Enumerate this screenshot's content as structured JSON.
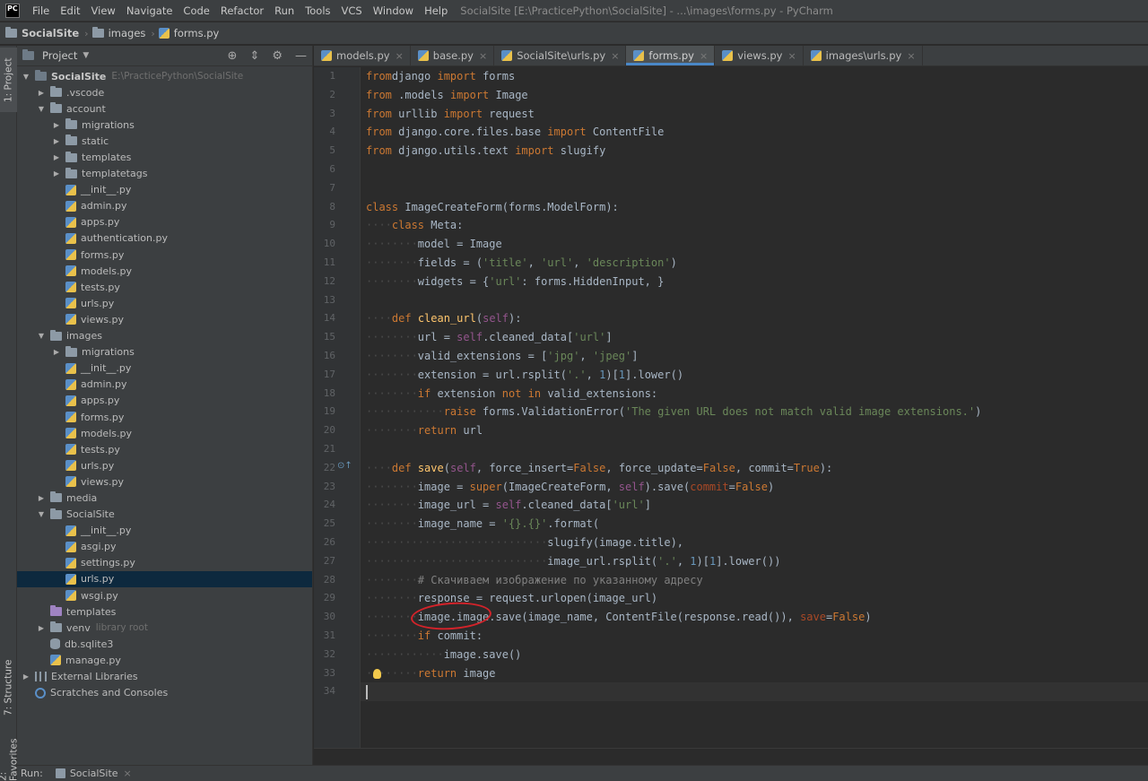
{
  "app": {
    "logo_text": "PC",
    "window_title": "SocialSite [E:\\PracticePython\\SocialSite] - ...\\images\\forms.py - PyCharm",
    "menu": [
      "File",
      "Edit",
      "View",
      "Navigate",
      "Code",
      "Refactor",
      "Run",
      "Tools",
      "VCS",
      "Window",
      "Help"
    ]
  },
  "breadcrumb": [
    "SocialSite",
    "images",
    "forms.py"
  ],
  "side_tabs": {
    "project": "1: Project",
    "structure": "7: Structure",
    "favorites": "2: Favorites"
  },
  "project_panel": {
    "title": "Project",
    "tree": [
      {
        "label": "SocialSite",
        "hint": "E:\\PracticePython\\SocialSite",
        "depth": 0,
        "type": "folder",
        "expanded": true,
        "bold": true
      },
      {
        "label": ".vscode",
        "depth": 1,
        "type": "folder",
        "expanded": false
      },
      {
        "label": "account",
        "depth": 1,
        "type": "folder",
        "expanded": true
      },
      {
        "label": "migrations",
        "depth": 2,
        "type": "folder",
        "expanded": false
      },
      {
        "label": "static",
        "depth": 2,
        "type": "folder",
        "expanded": false
      },
      {
        "label": "templates",
        "depth": 2,
        "type": "folder",
        "expanded": false
      },
      {
        "label": "templatetags",
        "depth": 2,
        "type": "folder",
        "expanded": false
      },
      {
        "label": "__init__.py",
        "depth": 2,
        "type": "py"
      },
      {
        "label": "admin.py",
        "depth": 2,
        "type": "py"
      },
      {
        "label": "apps.py",
        "depth": 2,
        "type": "py"
      },
      {
        "label": "authentication.py",
        "depth": 2,
        "type": "py"
      },
      {
        "label": "forms.py",
        "depth": 2,
        "type": "py"
      },
      {
        "label": "models.py",
        "depth": 2,
        "type": "py"
      },
      {
        "label": "tests.py",
        "depth": 2,
        "type": "py"
      },
      {
        "label": "urls.py",
        "depth": 2,
        "type": "py"
      },
      {
        "label": "views.py",
        "depth": 2,
        "type": "py"
      },
      {
        "label": "images",
        "depth": 1,
        "type": "folder",
        "expanded": true
      },
      {
        "label": "migrations",
        "depth": 2,
        "type": "folder",
        "expanded": false
      },
      {
        "label": "__init__.py",
        "depth": 2,
        "type": "py"
      },
      {
        "label": "admin.py",
        "depth": 2,
        "type": "py"
      },
      {
        "label": "apps.py",
        "depth": 2,
        "type": "py"
      },
      {
        "label": "forms.py",
        "depth": 2,
        "type": "py"
      },
      {
        "label": "models.py",
        "depth": 2,
        "type": "py"
      },
      {
        "label": "tests.py",
        "depth": 2,
        "type": "py"
      },
      {
        "label": "urls.py",
        "depth": 2,
        "type": "py"
      },
      {
        "label": "views.py",
        "depth": 2,
        "type": "py"
      },
      {
        "label": "media",
        "depth": 1,
        "type": "folder",
        "expanded": false
      },
      {
        "label": "SocialSite",
        "depth": 1,
        "type": "folder",
        "expanded": true
      },
      {
        "label": "__init__.py",
        "depth": 2,
        "type": "py"
      },
      {
        "label": "asgi.py",
        "depth": 2,
        "type": "py"
      },
      {
        "label": "settings.py",
        "depth": 2,
        "type": "py"
      },
      {
        "label": "urls.py",
        "depth": 2,
        "type": "py",
        "selected": true
      },
      {
        "label": "wsgi.py",
        "depth": 2,
        "type": "py"
      },
      {
        "label": "templates",
        "depth": 1,
        "type": "folder-purple",
        "leaf": true
      },
      {
        "label": "venv",
        "hint": "library root",
        "depth": 1,
        "type": "folder",
        "expanded": false
      },
      {
        "label": "db.sqlite3",
        "depth": 1,
        "type": "db"
      },
      {
        "label": "manage.py",
        "depth": 1,
        "type": "py"
      },
      {
        "label": "External Libraries",
        "depth": 0,
        "type": "lib",
        "expanded": false
      },
      {
        "label": "Scratches and Consoles",
        "depth": 0,
        "type": "scratch",
        "leaf": true
      }
    ]
  },
  "tabs": [
    {
      "label": "models.py",
      "active": false
    },
    {
      "label": "base.py",
      "active": false
    },
    {
      "label": "SocialSite\\urls.py",
      "active": false
    },
    {
      "label": "forms.py",
      "active": true
    },
    {
      "label": "views.py",
      "active": false
    },
    {
      "label": "images\\urls.py",
      "active": false
    }
  ],
  "editor": {
    "current_line": 34,
    "lines": [
      [
        [
          "kw",
          "from"
        ],
        [
          "",
          "django "
        ],
        [
          "kw",
          "import"
        ],
        [
          "",
          " forms"
        ]
      ],
      [
        [
          "kw",
          "from"
        ],
        [
          "",
          " .models "
        ],
        [
          "kw",
          "import"
        ],
        [
          "",
          " Image"
        ]
      ],
      [
        [
          "kw",
          "from"
        ],
        [
          "",
          " urllib "
        ],
        [
          "kw",
          "import"
        ],
        [
          "",
          " request"
        ]
      ],
      [
        [
          "kw",
          "from"
        ],
        [
          "",
          " django.core.files.base "
        ],
        [
          "kw",
          "import"
        ],
        [
          "",
          " ContentFile"
        ]
      ],
      [
        [
          "kw",
          "from"
        ],
        [
          "",
          " django.utils.text "
        ],
        [
          "kw",
          "import"
        ],
        [
          "",
          " slugify"
        ]
      ],
      [],
      [],
      [
        [
          "kw",
          "class"
        ],
        [
          "",
          " ImageCreateForm(forms.ModelForm):"
        ]
      ],
      [
        [
          "ws",
          "····"
        ],
        [
          "kw",
          "class"
        ],
        [
          "",
          " Meta:"
        ]
      ],
      [
        [
          "ws",
          "········"
        ],
        [
          "",
          "model = Image"
        ]
      ],
      [
        [
          "ws",
          "········"
        ],
        [
          "",
          "fields = ("
        ],
        [
          "str",
          "'title'"
        ],
        [
          "",
          ", "
        ],
        [
          "str",
          "'url'"
        ],
        [
          "",
          ", "
        ],
        [
          "str",
          "'description'"
        ],
        [
          "",
          ")"
        ]
      ],
      [
        [
          "ws",
          "········"
        ],
        [
          "",
          "widgets = {"
        ],
        [
          "str",
          "'url'"
        ],
        [
          "",
          ": forms.HiddenInput, }"
        ]
      ],
      [],
      [
        [
          "ws",
          "····"
        ],
        [
          "kw",
          "def"
        ],
        [
          "",
          " "
        ],
        [
          "fn",
          "clean_url"
        ],
        [
          "",
          "("
        ],
        [
          "self",
          "self"
        ],
        [
          "",
          "):"
        ]
      ],
      [
        [
          "ws",
          "········"
        ],
        [
          "",
          "url = "
        ],
        [
          "self",
          "self"
        ],
        [
          "",
          ".cleaned_data["
        ],
        [
          "str",
          "'url'"
        ],
        [
          "",
          "]"
        ]
      ],
      [
        [
          "ws",
          "········"
        ],
        [
          "",
          "valid_extensions = ["
        ],
        [
          "str",
          "'jpg'"
        ],
        [
          "",
          ", "
        ],
        [
          "str",
          "'jpeg'"
        ],
        [
          "",
          "]"
        ]
      ],
      [
        [
          "ws",
          "········"
        ],
        [
          "",
          "extension = url.rsplit("
        ],
        [
          "str",
          "'.'"
        ],
        [
          "",
          ", "
        ],
        [
          "num",
          "1"
        ],
        [
          "",
          ")["
        ],
        [
          "num",
          "1"
        ],
        [
          "",
          "].lower()"
        ]
      ],
      [
        [
          "ws",
          "········"
        ],
        [
          "kw",
          "if"
        ],
        [
          "",
          " extension "
        ],
        [
          "kw",
          "not in"
        ],
        [
          "",
          " valid_extensions:"
        ]
      ],
      [
        [
          "ws",
          "············"
        ],
        [
          "kw",
          "raise"
        ],
        [
          "",
          " forms.ValidationError("
        ],
        [
          "str",
          "'The given URL does not match valid image extensions.'"
        ],
        [
          "",
          ")"
        ]
      ],
      [
        [
          "ws",
          "········"
        ],
        [
          "kw",
          "return"
        ],
        [
          "",
          " url"
        ]
      ],
      [],
      [
        [
          "ws",
          "····"
        ],
        [
          "kw",
          "def"
        ],
        [
          "",
          " "
        ],
        [
          "fn",
          "save"
        ],
        [
          "",
          "("
        ],
        [
          "self",
          "self"
        ],
        [
          "",
          ", force_insert="
        ],
        [
          "kw",
          "False"
        ],
        [
          "",
          ", force_update="
        ],
        [
          "kw",
          "False"
        ],
        [
          "",
          ", commit="
        ],
        [
          "kw",
          "True"
        ],
        [
          "",
          "):"
        ]
      ],
      [
        [
          "ws",
          "········"
        ],
        [
          "",
          "image = "
        ],
        [
          "kw",
          "super"
        ],
        [
          "",
          "(ImageCreateForm, "
        ],
        [
          "self",
          "self"
        ],
        [
          "",
          ").save("
        ],
        [
          "kwarg",
          "commit"
        ],
        [
          "",
          "="
        ],
        [
          "kw",
          "False"
        ],
        [
          "",
          ")"
        ]
      ],
      [
        [
          "ws",
          "········"
        ],
        [
          "",
          "image_url = "
        ],
        [
          "self",
          "self"
        ],
        [
          "",
          ".cleaned_data["
        ],
        [
          "str",
          "'url'"
        ],
        [
          "",
          "]"
        ]
      ],
      [
        [
          "ws",
          "········"
        ],
        [
          "",
          "image_name = "
        ],
        [
          "str",
          "'{}.{}'"
        ],
        [
          "",
          ".format("
        ]
      ],
      [
        [
          "ws",
          "····························"
        ],
        [
          "",
          "slugify(image.title),"
        ]
      ],
      [
        [
          "ws",
          "····························"
        ],
        [
          "",
          "image_url.rsplit("
        ],
        [
          "str",
          "'.'"
        ],
        [
          "",
          ", "
        ],
        [
          "num",
          "1"
        ],
        [
          "",
          ")["
        ],
        [
          "num",
          "1"
        ],
        [
          "",
          "].lower())"
        ]
      ],
      [
        [
          "ws",
          "········"
        ],
        [
          "cmt",
          "# Скачиваем изображение по указанному адресу"
        ]
      ],
      [
        [
          "ws",
          "········"
        ],
        [
          "",
          "response = request.urlopen(image_url)"
        ]
      ],
      [
        [
          "ws",
          "········"
        ],
        [
          "",
          "image.image.save(image_name, ContentFile(response.read()), "
        ],
        [
          "kwarg",
          "save"
        ],
        [
          "",
          "="
        ],
        [
          "kw",
          "False"
        ],
        [
          "",
          ")"
        ]
      ],
      [
        [
          "ws",
          "········"
        ],
        [
          "kw",
          "if"
        ],
        [
          "",
          " commit:"
        ]
      ],
      [
        [
          "ws",
          "············"
        ],
        [
          "",
          "image.save()"
        ]
      ],
      [
        [
          "ws",
          "········"
        ],
        [
          "kw",
          "return"
        ],
        [
          "",
          " image"
        ]
      ],
      []
    ]
  },
  "bottom_bar": {
    "run_label": "Run:",
    "run_config": "SocialSite"
  },
  "colors": {
    "accent": "#4a88c7",
    "annotation": "#d3232a",
    "selection": "#0d293e"
  }
}
